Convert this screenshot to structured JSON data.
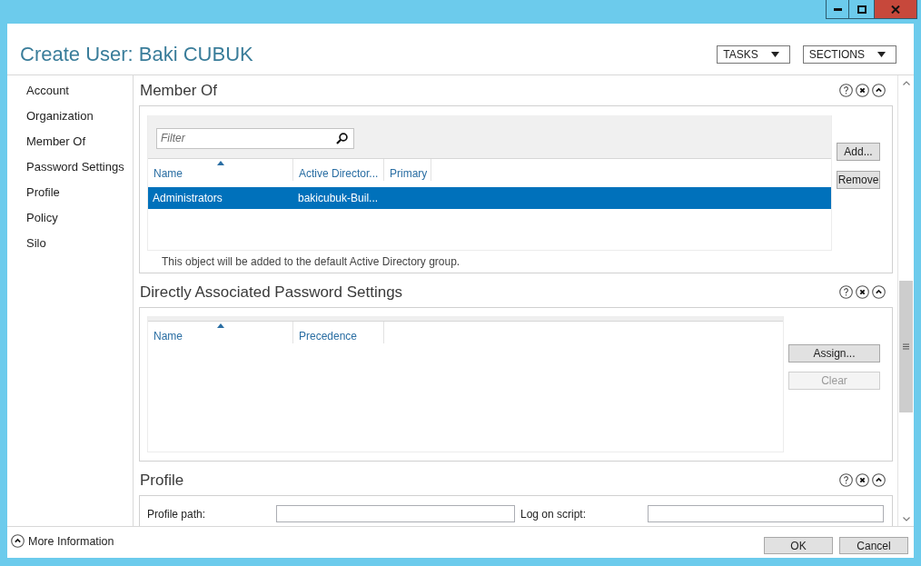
{
  "window": {
    "title": "Create User: Baki CUBUK"
  },
  "header_buttons": [
    {
      "label": "TASKS"
    },
    {
      "label": "SECTIONS"
    }
  ],
  "sidebar": {
    "items": [
      {
        "label": "Account"
      },
      {
        "label": "Organization"
      },
      {
        "label": "Member Of"
      },
      {
        "label": "Password Settings"
      },
      {
        "label": "Profile"
      },
      {
        "label": "Policy"
      },
      {
        "label": "Silo"
      }
    ]
  },
  "sections": [
    {
      "kind": "member_of",
      "title": "Member Of",
      "filter": {
        "placeholder": "Filter"
      },
      "table": {
        "columns": [
          {
            "label": "Name",
            "sorted": true
          },
          {
            "label": "Active Director...",
            "sorted": false
          },
          {
            "label": "Primary",
            "sorted": false
          }
        ],
        "rows": [
          {
            "cells": [
              "Administrators",
              "bakicubuk-Buil..."
            ],
            "selected": true
          }
        ]
      },
      "note": "This object will be added to the default Active Directory group.",
      "buttons": [
        {
          "label": "Add...",
          "disabled": false
        },
        {
          "label": "Remove",
          "disabled": false
        }
      ]
    },
    {
      "kind": "password_settings",
      "title": "Directly Associated Password Settings",
      "table": {
        "columns": [
          {
            "label": "Name",
            "sorted": true
          },
          {
            "label": "Precedence",
            "sorted": false
          }
        ]
      },
      "buttons": [
        {
          "label": "Assign...",
          "disabled": false
        },
        {
          "label": "Clear",
          "disabled": true
        }
      ]
    },
    {
      "kind": "profile",
      "title": "Profile",
      "fields": [
        {
          "label": "Profile path:"
        },
        {
          "label": "Log on script:"
        }
      ]
    }
  ],
  "footer": {
    "more_info": "More Information",
    "buttons": [
      {
        "label": "OK"
      },
      {
        "label": "Cancel"
      }
    ]
  }
}
